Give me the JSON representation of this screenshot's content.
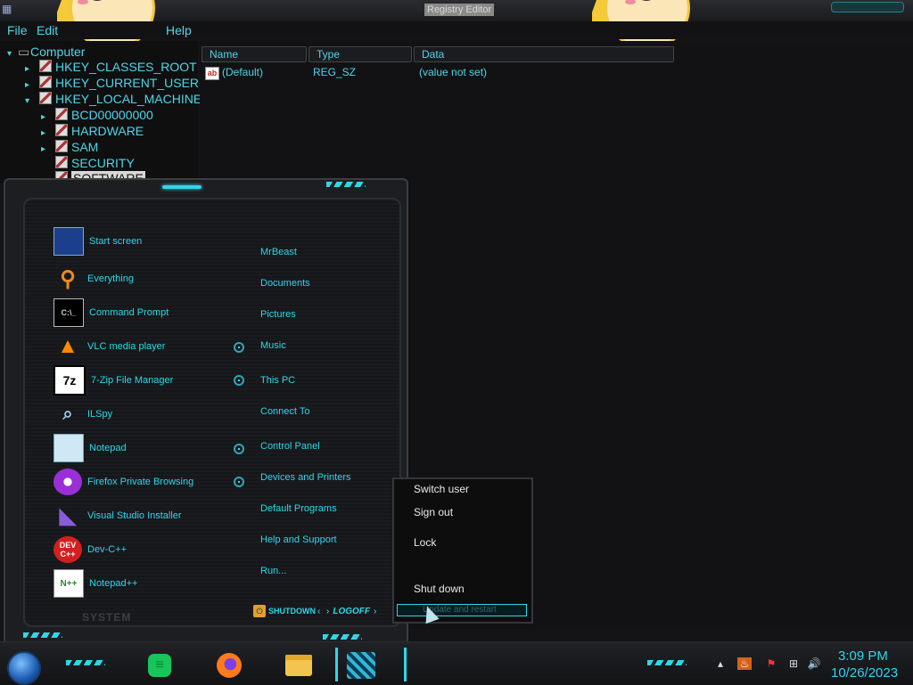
{
  "window": {
    "title": "Registry Editor"
  },
  "menubar": {
    "file": "File",
    "edit": "Edit",
    "help": "Help"
  },
  "tree": {
    "root": "Computer",
    "items": [
      {
        "label": "HKEY_CLASSES_ROOT"
      },
      {
        "label": "HKEY_CURRENT_USER"
      },
      {
        "label": "HKEY_LOCAL_MACHINE"
      },
      {
        "label": "BCD00000000"
      },
      {
        "label": "HARDWARE"
      },
      {
        "label": "SAM"
      },
      {
        "label": "SECURITY"
      },
      {
        "label": "SOFTWARE"
      }
    ]
  },
  "list": {
    "headers": {
      "name": "Name",
      "type": "Type",
      "data": "Data"
    },
    "rows": [
      {
        "name": "(Default)",
        "type": "REG_SZ",
        "data": "(value not set)"
      }
    ]
  },
  "startmenu": {
    "programs": [
      {
        "label": "Start screen",
        "icon": "start-screen-icon"
      },
      {
        "label": "Everything",
        "icon": "magnifier-icon"
      },
      {
        "label": "Command Prompt",
        "icon": "terminal-icon"
      },
      {
        "label": "VLC media player",
        "icon": "vlc-cone-icon"
      },
      {
        "label": "7-Zip File Manager",
        "icon": "7zip-icon",
        "icon_text": "7z"
      },
      {
        "label": "ILSpy",
        "icon": "ilspy-icon"
      },
      {
        "label": "Notepad",
        "icon": "notepad-icon"
      },
      {
        "label": "Firefox Private Browsing",
        "icon": "firefox-private-icon"
      },
      {
        "label": "Visual Studio Installer",
        "icon": "vs-installer-icon"
      },
      {
        "label": "Dev-C++",
        "icon": "devcpp-icon",
        "icon_text": "DEV C++"
      },
      {
        "label": "Notepad++",
        "icon": "notepadpp-icon"
      }
    ],
    "places": [
      {
        "label": "MrBeast"
      },
      {
        "label": "Documents"
      },
      {
        "label": "Pictures"
      },
      {
        "label": "Music"
      },
      {
        "label": "This PC"
      },
      {
        "label": "Connect To"
      },
      {
        "label": "Control Panel"
      },
      {
        "label": "Devices and Printers"
      },
      {
        "label": "Default Programs"
      },
      {
        "label": "Help and Support"
      },
      {
        "label": "Run..."
      }
    ],
    "footer": {
      "system": "SYSTEM",
      "shutdown": "SHUTDOWN",
      "logoff": "LOGOFF"
    }
  },
  "powermenu": {
    "items": [
      {
        "label": "Switch user"
      },
      {
        "label": "Sign out"
      },
      {
        "label": "Lock"
      },
      {
        "label": "Shut down"
      },
      {
        "label": "Update and restart"
      }
    ]
  },
  "taskbar": {
    "apps": [
      {
        "name": "notes-app-icon"
      },
      {
        "name": "firefox-icon"
      },
      {
        "name": "file-explorer-icon"
      },
      {
        "name": "registry-editor-icon"
      }
    ],
    "clock": {
      "time": "3:09 PM",
      "date": "10/26/2023"
    }
  },
  "colors": {
    "accent": "#2fd6e8",
    "background": "#141416"
  }
}
